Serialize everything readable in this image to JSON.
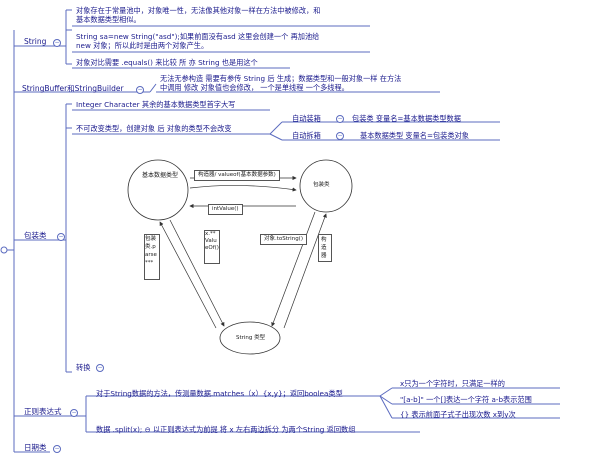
{
  "root": {
    "string": "String",
    "stringbuffer": "StringBuffer和StringBuilder",
    "wrapper": "包装类",
    "regex": "正则表达式",
    "date": "日期类"
  },
  "string_notes": {
    "note1_l1": "对象存在于常量池中，对象唯一性，无法像其他对象一样在方法中被修改，和",
    "note1_l2": "基本数据类型相似。",
    "note2_l1": "String sa=new String(\"asd\");如果前面没有asd 这里会创建一个  再加池给",
    "note2_l2": "new  对象；所以此时是由两个对象产生。",
    "note3": "对象对比需要  .equals()  来比较  所 亦  String  也是用这个"
  },
  "sb_note": {
    "l1": "无法无参构造  需要有参传 String  后 生成；数据类型和一般对象一样  在方法",
    "l2": "中调用 修改 对象值也会修改，  一个是单线程 一个多线程。"
  },
  "wrapper_notes": {
    "n1": "Integer  Character 其余的基本数据类型首字大写",
    "n2": "不可改变类型，创建对象 后  对象的类型不会改变",
    "autobox": "自动装箱",
    "autobox_desc": "包装类 变量名=基本数据类型数据",
    "autounbox": "自动拆箱",
    "autounbox_desc": "基本数据类型  变量名=包装类对象",
    "convert": "转换"
  },
  "diagram": {
    "basic_type": "基本数据类型",
    "wrapper_class": "包装类",
    "string_type": "String 类型",
    "ctor": "构造器/ valueof(基本数据参数)",
    "intvalue": "intValue()",
    "tostring": "对象.toString()",
    "constructor": "构造器",
    "valueof_l1": "x.**",
    "valueof_l2": "Valu",
    "valueof_l3": "eOf()",
    "wrap_l1": "包装",
    "wrap_l2": "类.p",
    "wrap_l3": "arse",
    "wrap_l4": "***"
  },
  "regex_notes": {
    "n1": "对于String数据的方法，传测量数据.matches（x）{x,y}；返回boolea类型",
    "n2": "数据 .split(x);   ⊖     以正则表达式为前提  将 x 左右两边拆分   为两个String  返回数组",
    "c1": "x只为一个字符时，只满足一样的",
    "c2": "\"[a-b]\" 一个[]表达一个字符  a-b表示范围",
    "c3": "{} 表示前面子式子出现次数 x到y次"
  },
  "colors": {
    "line": "#5b6bbf",
    "text": "#1a1a8c"
  }
}
